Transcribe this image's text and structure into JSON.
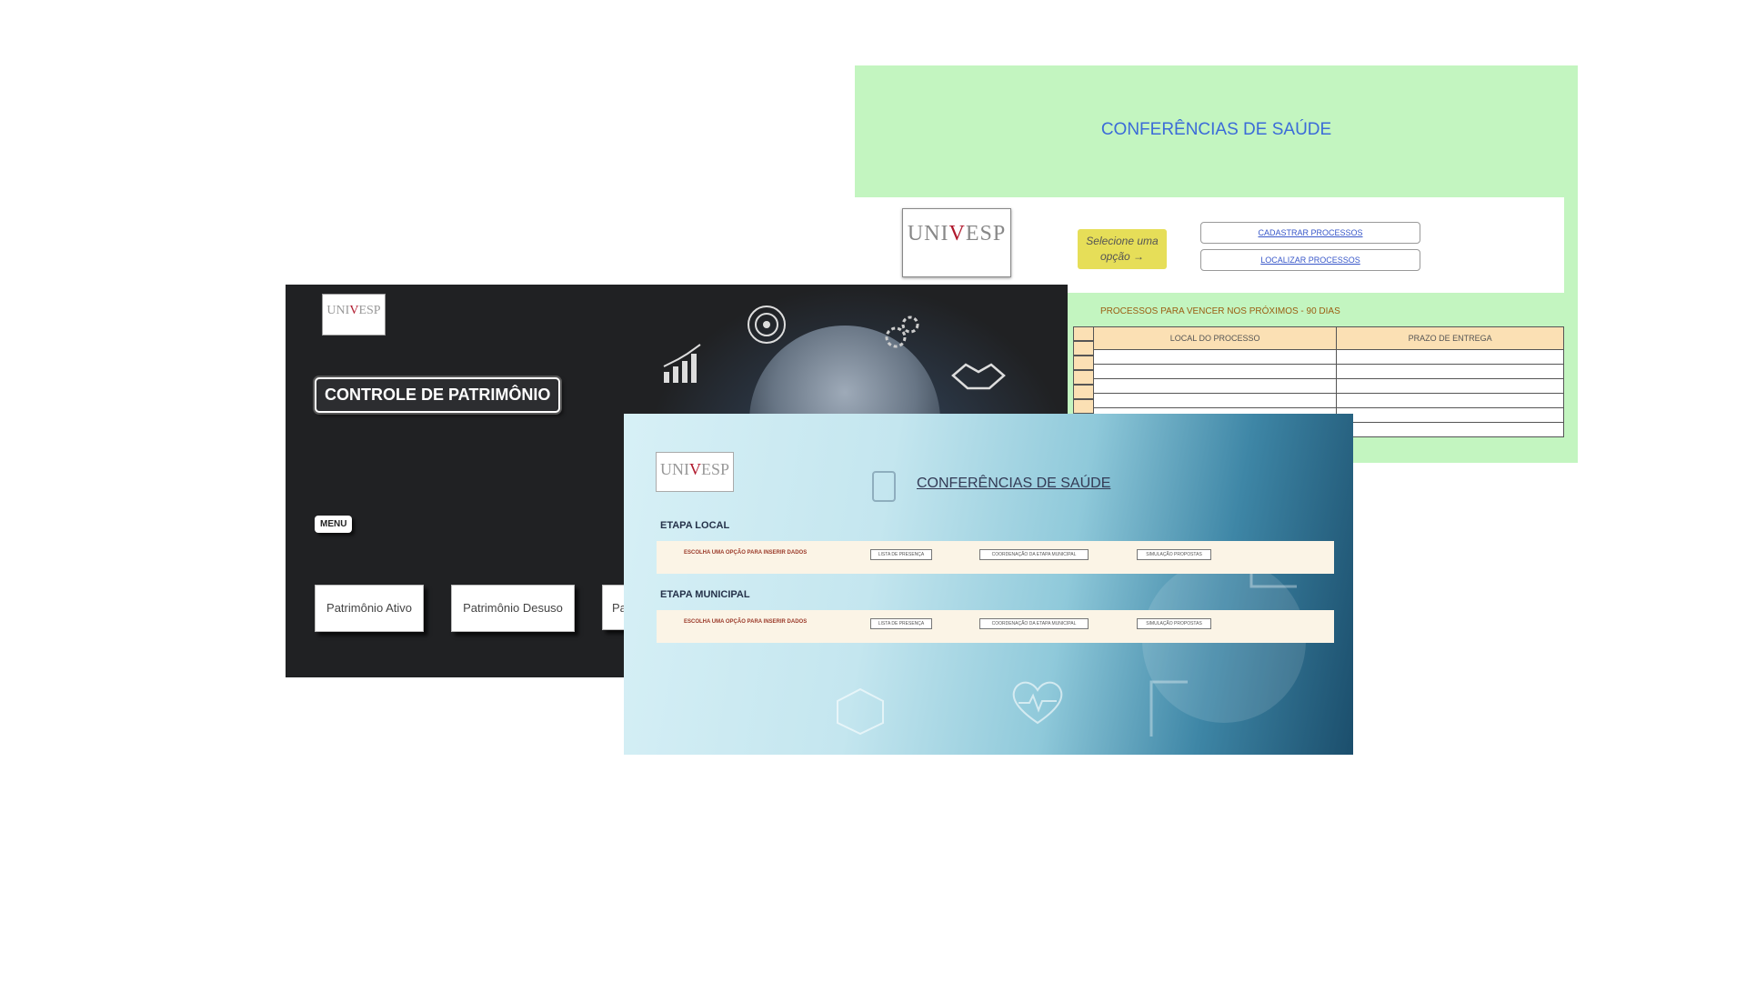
{
  "green_panel": {
    "title": "CONFERÊNCIAS DE SAÚDE",
    "logo_text_left": "UNI",
    "logo_text_v": "V",
    "logo_text_right": "ESP",
    "select_hint_line1": "Selecione uma",
    "select_hint_line2": "opção →",
    "buttons": [
      "CADASTRAR PROCESSOS",
      "LOCALIZAR PROCESSOS"
    ],
    "notice": "PROCESSOS PARA VENCER NOS PRÓXIMOS - 90 DIAS",
    "table_headers": [
      "LOCAL DO PROCESSO",
      "PRAZO DE ENTREGA"
    ]
  },
  "dark_panel": {
    "logo_text_left": "UNI",
    "logo_text_v": "V",
    "logo_text_right": "ESP",
    "title": "CONTROLE DE PATRIMÔNIO",
    "menu_label": "MENU",
    "buttons": [
      "Patrimônio Ativo",
      "Patrimônio Desuso",
      "Pa"
    ]
  },
  "blue_panel": {
    "logo_text_left": "UNI",
    "logo_text_v": "V",
    "logo_text_right": "ESP",
    "title": "CONFERÊNCIAS DE SAÚDE",
    "sections": [
      {
        "label": "ETAPA LOCAL",
        "hint": "ESCOLHA UMA OPÇÃO PARA INSERIR DADOS",
        "options": [
          "LISTA DE PRESENÇA",
          "COORDENAÇÃO DA ETAPA MUNICIPAL",
          "SIMULAÇÃO PROPOSTAS"
        ]
      },
      {
        "label": "ETAPA MUNICIPAL",
        "hint": "ESCOLHA UMA OPÇÃO PARA INSERIR DADOS",
        "options": [
          "LISTA DE PRESENÇA",
          "COORDENAÇÃO DA ETAPA MUNICIPAL",
          "SIMULAÇÃO PROPOSTAS"
        ]
      }
    ]
  }
}
